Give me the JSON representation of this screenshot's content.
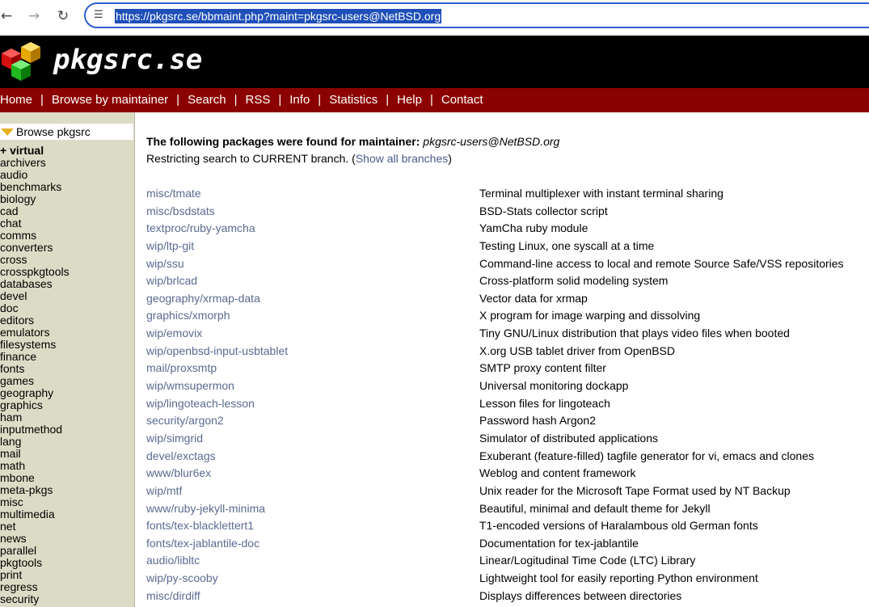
{
  "browser": {
    "back_icon": "arrow-left-icon",
    "forward_icon": "arrow-right-icon",
    "reload_icon": "reload-icon",
    "site_info_icon": "tune-icon",
    "url": "https://pkgsrc.se/bbmaint.php?maint=pkgsrc-users@NetBSD.org"
  },
  "header": {
    "site_name": "pkgsrc.se",
    "logo_icon": "cubes-logo-icon"
  },
  "menu": [
    {
      "label": "Home"
    },
    {
      "label": "Browse by maintainer"
    },
    {
      "label": "Search"
    },
    {
      "label": "RSS"
    },
    {
      "label": "Info"
    },
    {
      "label": "Statistics"
    },
    {
      "label": "Help"
    },
    {
      "label": "Contact"
    }
  ],
  "sidebar": {
    "title": "Browse pkgsrc",
    "virtual_label": "+ virtual",
    "categories": [
      "archivers",
      "audio",
      "benchmarks",
      "biology",
      "cad",
      "chat",
      "comms",
      "converters",
      "cross",
      "crosspkgtools",
      "databases",
      "devel",
      "doc",
      "editors",
      "emulators",
      "filesystems",
      "finance",
      "fonts",
      "games",
      "geography",
      "graphics",
      "ham",
      "inputmethod",
      "lang",
      "mail",
      "math",
      "mbone",
      "meta-pkgs",
      "misc",
      "multimedia",
      "net",
      "news",
      "parallel",
      "pkgtools",
      "print",
      "regress",
      "security"
    ]
  },
  "main": {
    "found_label": "The following packages were found for maintainer:",
    "maintainer": "pkgsrc-users@NetBSD.org",
    "restrict_text": "Restricting search to CURRENT branch. (",
    "show_all_link": "Show all branches",
    "restrict_close": ")",
    "packages": [
      {
        "name": "misc/tmate",
        "desc": "Terminal multiplexer with instant terminal sharing"
      },
      {
        "name": "misc/bsdstats",
        "desc": "BSD-Stats collector script"
      },
      {
        "name": "textproc/ruby-yamcha",
        "desc": "YamCha ruby module"
      },
      {
        "name": "wip/ltp-git",
        "desc": "Testing Linux, one syscall at a time"
      },
      {
        "name": "wip/ssu",
        "desc": "Command-line access to local and remote Source Safe/VSS repositories"
      },
      {
        "name": "wip/brlcad",
        "desc": "Cross-platform solid modeling system"
      },
      {
        "name": "geography/xrmap-data",
        "desc": "Vector data for xrmap"
      },
      {
        "name": "graphics/xmorph",
        "desc": "X program for image warping and dissolving"
      },
      {
        "name": "wip/emovix",
        "desc": "Tiny GNU/Linux distribution that plays video files when booted"
      },
      {
        "name": "wip/openbsd-input-usbtablet",
        "desc": "X.org USB tablet driver from OpenBSD"
      },
      {
        "name": "mail/proxsmtp",
        "desc": "SMTP proxy content filter"
      },
      {
        "name": "wip/wmsupermon",
        "desc": "Universal monitoring dockapp"
      },
      {
        "name": "wip/lingoteach-lesson",
        "desc": "Lesson files for lingoteach"
      },
      {
        "name": "security/argon2",
        "desc": "Password hash Argon2"
      },
      {
        "name": "wip/simgrid",
        "desc": "Simulator of distributed applications"
      },
      {
        "name": "devel/exctags",
        "desc": "Exuberant (feature-filled) tagfile generator for vi, emacs and clones"
      },
      {
        "name": "www/blur6ex",
        "desc": "Weblog and content framework"
      },
      {
        "name": "wip/mtf",
        "desc": "Unix reader for the Microsoft Tape Format used by NT Backup"
      },
      {
        "name": "www/ruby-jekyll-minima",
        "desc": "Beautiful, minimal and default theme for Jekyll"
      },
      {
        "name": "fonts/tex-blacklettert1",
        "desc": "T1-encoded versions of Haralambous old German fonts"
      },
      {
        "name": "fonts/tex-jablantile-doc",
        "desc": "Documentation for tex-jablantile"
      },
      {
        "name": "audio/libltc",
        "desc": "Linear/Logitudinal Time Code (LTC) Library"
      },
      {
        "name": "wip/py-scooby",
        "desc": "Lightweight tool for easily reporting Python environment"
      },
      {
        "name": "misc/dirdiff",
        "desc": "Displays differences between directories"
      }
    ]
  },
  "colors": {
    "menu_bar": "#8b0000",
    "banner": "#000000",
    "sidebar": "#dcdcc6",
    "link": "#5a6a90",
    "url_highlight": "#1f4fb8"
  }
}
